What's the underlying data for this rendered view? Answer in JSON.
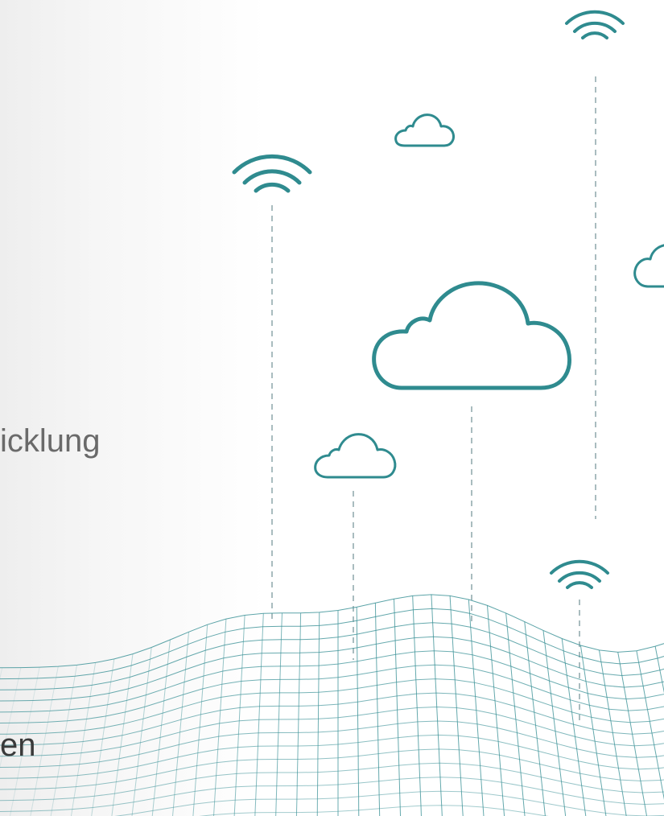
{
  "fragments": {
    "text_1": "icklung",
    "text_2": "en"
  },
  "colors": {
    "accent": "#2f8b8f",
    "mesh": "#3b8f95",
    "dash": "#9fb4b8",
    "text": "#585858"
  },
  "icons": [
    "wifi-icon",
    "cloud-icon",
    "wireframe-landscape"
  ]
}
